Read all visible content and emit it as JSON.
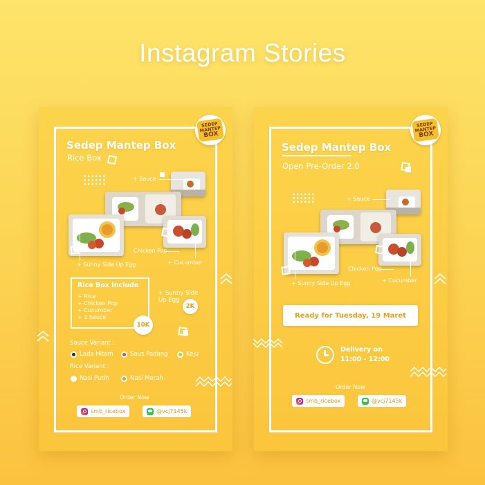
{
  "heading": "Instagram Stories",
  "colors": {
    "brand_yellow": "#fcd44c",
    "accent_orange": "#e1a21b",
    "white": "#ffffff"
  },
  "logo": {
    "line1": "SEDEP",
    "line2": "MANTEP",
    "line3": "BOX"
  },
  "left_story": {
    "title": "Sedep Mantep Box",
    "subtitle": "Rice Box",
    "labels": {
      "sauce": "+ Sauce",
      "chicken_pop": "Chicken Pop",
      "sunny_side": "+ Sunny Side Up Egg",
      "cucumber": "+ Cucumber"
    },
    "include": {
      "heading": "Rice Box Include",
      "items": [
        "+ Rice",
        "+ Chicken Pop",
        "+ Cucumber",
        "+ 1 Sauce"
      ],
      "price": "10K"
    },
    "addon": {
      "line1": "+ Sunny Side",
      "line2": "Up Egg",
      "price": "2K"
    },
    "sauce_variant": {
      "label": "Sauce Variant :",
      "options": [
        {
          "name": "Lada Hitam",
          "color": "#3a2a1a"
        },
        {
          "name": "Saus Padang",
          "color": "#d6532a"
        },
        {
          "name": "Keju",
          "color": "#a8d63a"
        }
      ]
    },
    "rice_variant": {
      "label": "Rice Variant :",
      "options": [
        {
          "name": "Nasi Putih",
          "color": "#ffffff"
        },
        {
          "name": "Nasi Merah",
          "color": "#e1a21b"
        }
      ]
    },
    "order_now": "Order Now",
    "instagram": "smb_ricebox",
    "line": "@vcj7145k"
  },
  "right_story": {
    "title": "Sedep Mantep Box",
    "subtitle": "Open Pre-Order 2.0",
    "labels": {
      "sauce": "+ Sauce",
      "chicken_pop": "Chicken Pop",
      "sunny_side": "+ Sunny Side Up Egg",
      "cucumber": "+ Cucumber"
    },
    "ready": "Ready for Tuesday, 19 Maret",
    "delivery_line1": "Delivery on",
    "delivery_line2": "11:00 - 12:00",
    "order_now": "Order Now",
    "instagram": "smb_ricebox",
    "line": "@vcj7145k"
  }
}
